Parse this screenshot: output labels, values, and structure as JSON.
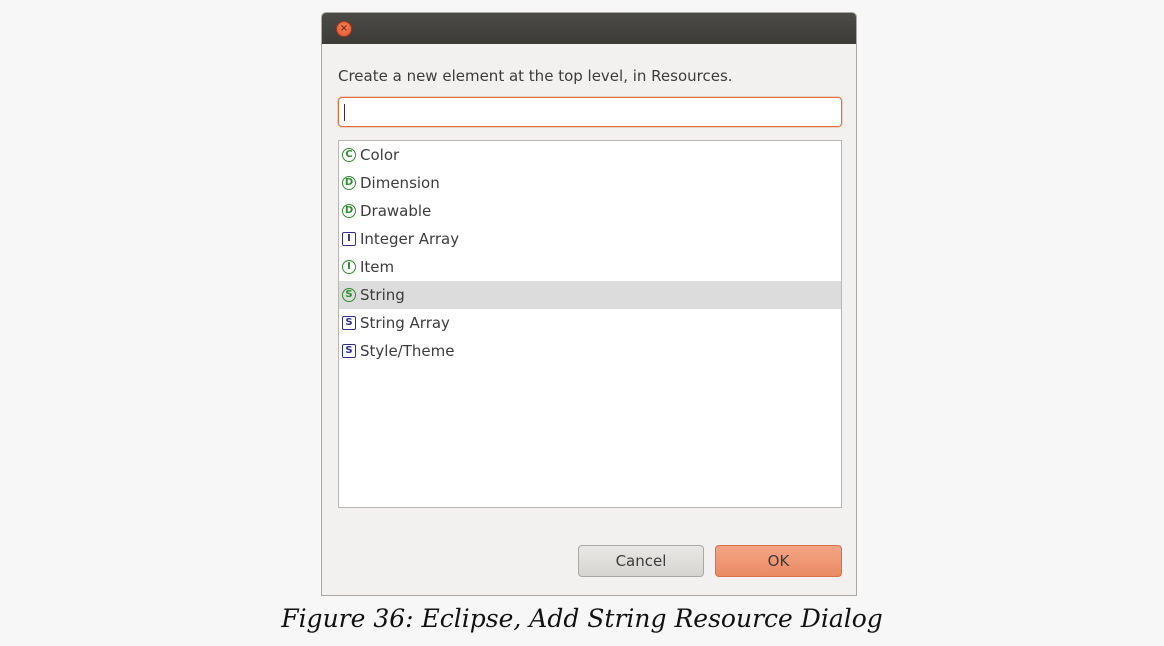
{
  "dialog": {
    "prompt": "Create a new element at the top level, in Resources.",
    "search": {
      "value": "",
      "placeholder": ""
    },
    "items": [
      {
        "badge": "C",
        "shape": "circle",
        "label": "Color",
        "selected": false
      },
      {
        "badge": "D",
        "shape": "circle",
        "label": "Dimension",
        "selected": false
      },
      {
        "badge": "D",
        "shape": "circle",
        "label": "Drawable",
        "selected": false
      },
      {
        "badge": "I",
        "shape": "square",
        "label": "Integer Array",
        "selected": false
      },
      {
        "badge": "I",
        "shape": "circle",
        "label": "Item",
        "selected": false
      },
      {
        "badge": "S",
        "shape": "circle",
        "label": "String",
        "selected": true
      },
      {
        "badge": "S",
        "shape": "square",
        "label": "String Array",
        "selected": false
      },
      {
        "badge": "S",
        "shape": "square",
        "label": "Style/Theme",
        "selected": false
      }
    ],
    "buttons": {
      "cancel": "Cancel",
      "ok": "OK"
    },
    "colors": {
      "accent": "#e06f3d",
      "titlebar": "#3c3b37",
      "circle_badge": "#2e8b2e",
      "square_badge": "#2c2f8a",
      "selection": "#dcdcdc"
    }
  },
  "caption": "Figure 36: Eclipse, Add String Resource Dialog"
}
